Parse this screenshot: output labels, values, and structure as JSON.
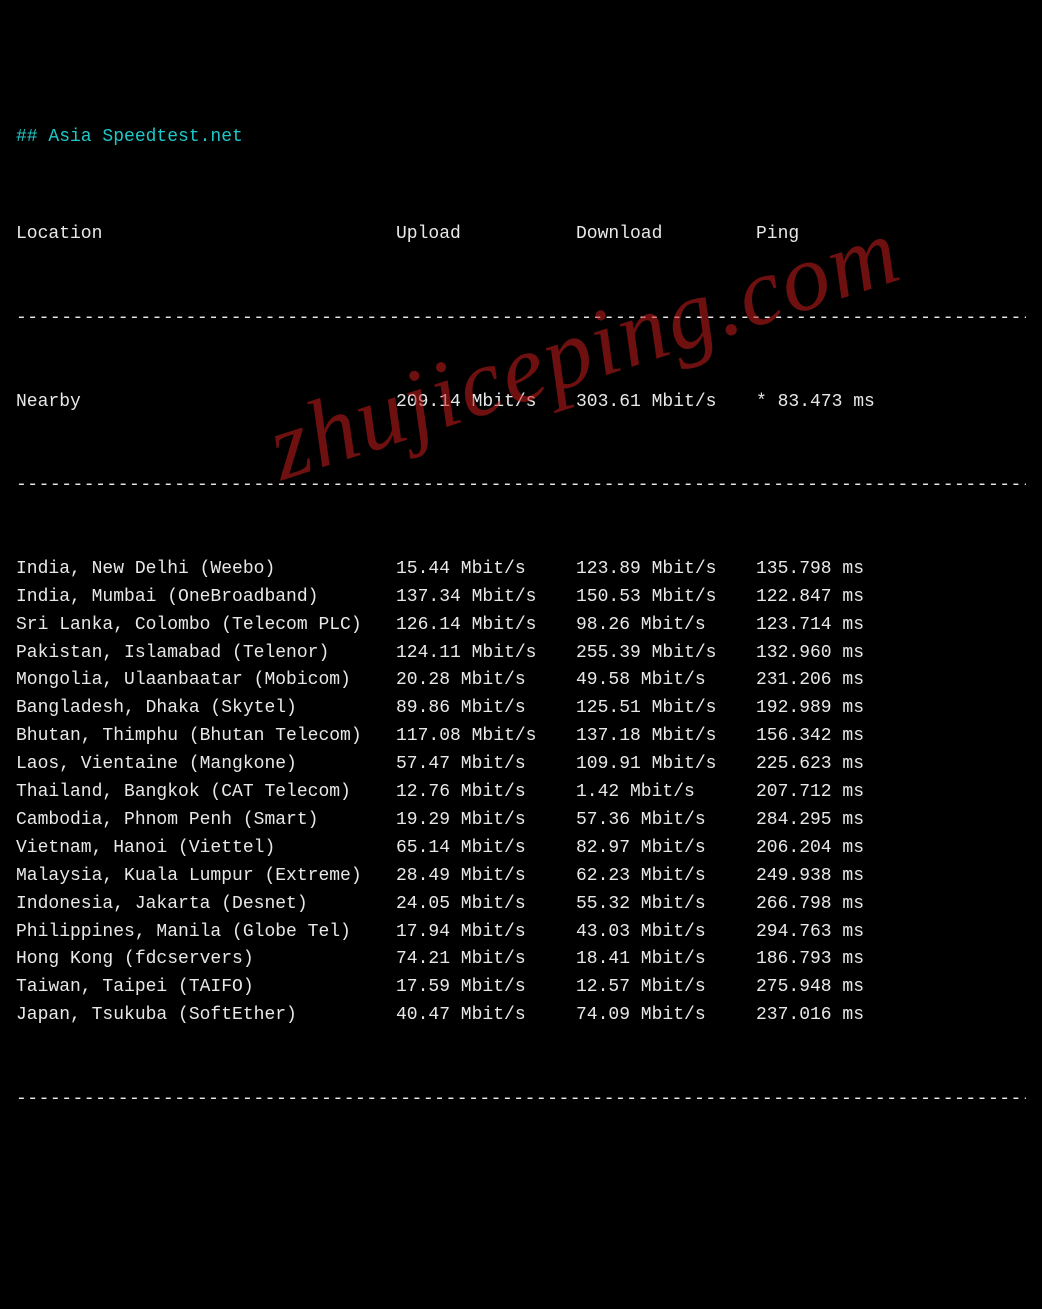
{
  "title_prefix": "## ",
  "title": "Asia Speedtest.net",
  "separator": "--------------------------------------------------------------------------------------------",
  "headers": {
    "location": "Location",
    "upload": "Upload",
    "download": "Download",
    "ping": "Ping"
  },
  "nearby": {
    "location": "Nearby",
    "upload": "209.14 Mbit/s",
    "download": "303.61 Mbit/s",
    "ping": "* 83.473 ms"
  },
  "rows": [
    {
      "location": "India, New Delhi (Weebo)",
      "upload": "15.44 Mbit/s",
      "download": "123.89 Mbit/s",
      "ping": "135.798 ms"
    },
    {
      "location": "India, Mumbai (OneBroadband)",
      "upload": "137.34 Mbit/s",
      "download": "150.53 Mbit/s",
      "ping": "122.847 ms"
    },
    {
      "location": "Sri Lanka, Colombo (Telecom PLC)",
      "upload": "126.14 Mbit/s",
      "download": "98.26 Mbit/s",
      "ping": "123.714 ms"
    },
    {
      "location": "Pakistan, Islamabad (Telenor)",
      "upload": "124.11 Mbit/s",
      "download": "255.39 Mbit/s",
      "ping": "132.960 ms"
    },
    {
      "location": "Mongolia, Ulaanbaatar (Mobicom)",
      "upload": "20.28 Mbit/s",
      "download": "49.58 Mbit/s",
      "ping": "231.206 ms"
    },
    {
      "location": "Bangladesh, Dhaka (Skytel)",
      "upload": "89.86 Mbit/s",
      "download": "125.51 Mbit/s",
      "ping": "192.989 ms"
    },
    {
      "location": "Bhutan, Thimphu (Bhutan Telecom)",
      "upload": "117.08 Mbit/s",
      "download": "137.18 Mbit/s",
      "ping": "156.342 ms"
    },
    {
      "location": "Laos, Vientaine (Mangkone)",
      "upload": "57.47 Mbit/s",
      "download": "109.91 Mbit/s",
      "ping": "225.623 ms"
    },
    {
      "location": "Thailand, Bangkok (CAT Telecom)",
      "upload": "12.76 Mbit/s",
      "download": "1.42 Mbit/s",
      "ping": "207.712 ms"
    },
    {
      "location": "Cambodia, Phnom Penh (Smart)",
      "upload": "19.29 Mbit/s",
      "download": "57.36 Mbit/s",
      "ping": "284.295 ms"
    },
    {
      "location": "Vietnam, Hanoi (Viettel)",
      "upload": "65.14 Mbit/s",
      "download": "82.97 Mbit/s",
      "ping": "206.204 ms"
    },
    {
      "location": "Malaysia, Kuala Lumpur (Extreme)",
      "upload": "28.49 Mbit/s",
      "download": "62.23 Mbit/s",
      "ping": "249.938 ms"
    },
    {
      "location": "Indonesia, Jakarta (Desnet)",
      "upload": "24.05 Mbit/s",
      "download": "55.32 Mbit/s",
      "ping": "266.798 ms"
    },
    {
      "location": "Philippines, Manila (Globe Tel)",
      "upload": "17.94 Mbit/s",
      "download": "43.03 Mbit/s",
      "ping": "294.763 ms"
    },
    {
      "location": "Hong Kong (fdcservers)",
      "upload": "74.21 Mbit/s",
      "download": "18.41 Mbit/s",
      "ping": "186.793 ms"
    },
    {
      "location": "Taiwan, Taipei (TAIFO)",
      "upload": "17.59 Mbit/s",
      "download": "12.57 Mbit/s",
      "ping": "275.948 ms"
    },
    {
      "location": "Japan, Tsukuba (SoftEther)",
      "upload": "40.47 Mbit/s",
      "download": "74.09 Mbit/s",
      "ping": "237.016 ms"
    }
  ],
  "watermark": "zhujiceping.com"
}
